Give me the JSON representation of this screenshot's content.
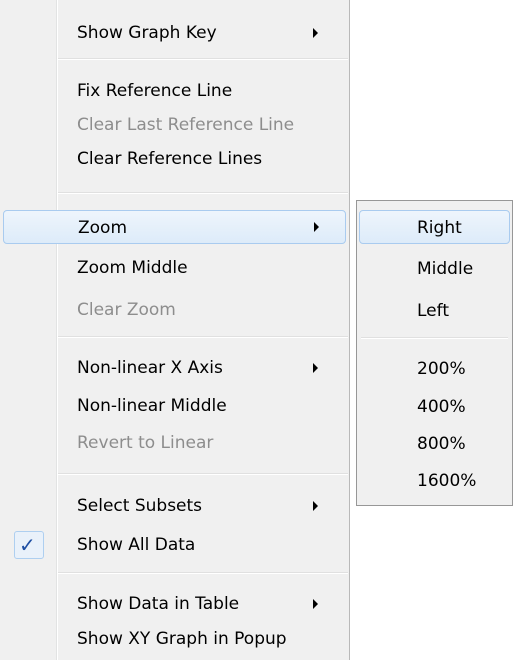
{
  "menu": {
    "show_graph_key": "Show Graph Key",
    "fix_reference_line": "Fix Reference Line",
    "clear_last_reference_line": "Clear Last Reference Line",
    "clear_reference_lines": "Clear Reference Lines",
    "zoom": "Zoom",
    "zoom_middle": "Zoom Middle",
    "clear_zoom": "Clear Zoom",
    "nonlinear_x_axis": "Non-linear X Axis",
    "nonlinear_middle": "Non-linear Middle",
    "revert_to_linear": "Revert to Linear",
    "select_subsets": "Select Subsets",
    "show_all_data": "Show All Data",
    "show_all_data_check": "✓",
    "show_data_in_table": "Show Data in Table",
    "show_xy_graph_in_popup": "Show XY Graph in Popup"
  },
  "zoom_submenu": {
    "right": "Right",
    "middle": "Middle",
    "left": "Left",
    "p200": "200%",
    "p400": "400%",
    "p800": "800%",
    "p1600": "1600%"
  },
  "colors": {
    "menu_bg": "#f0f0f0",
    "highlight_border": "#a9cbef",
    "disabled_text": "#8d8d8d",
    "check_mark": "#1f4fa3"
  }
}
